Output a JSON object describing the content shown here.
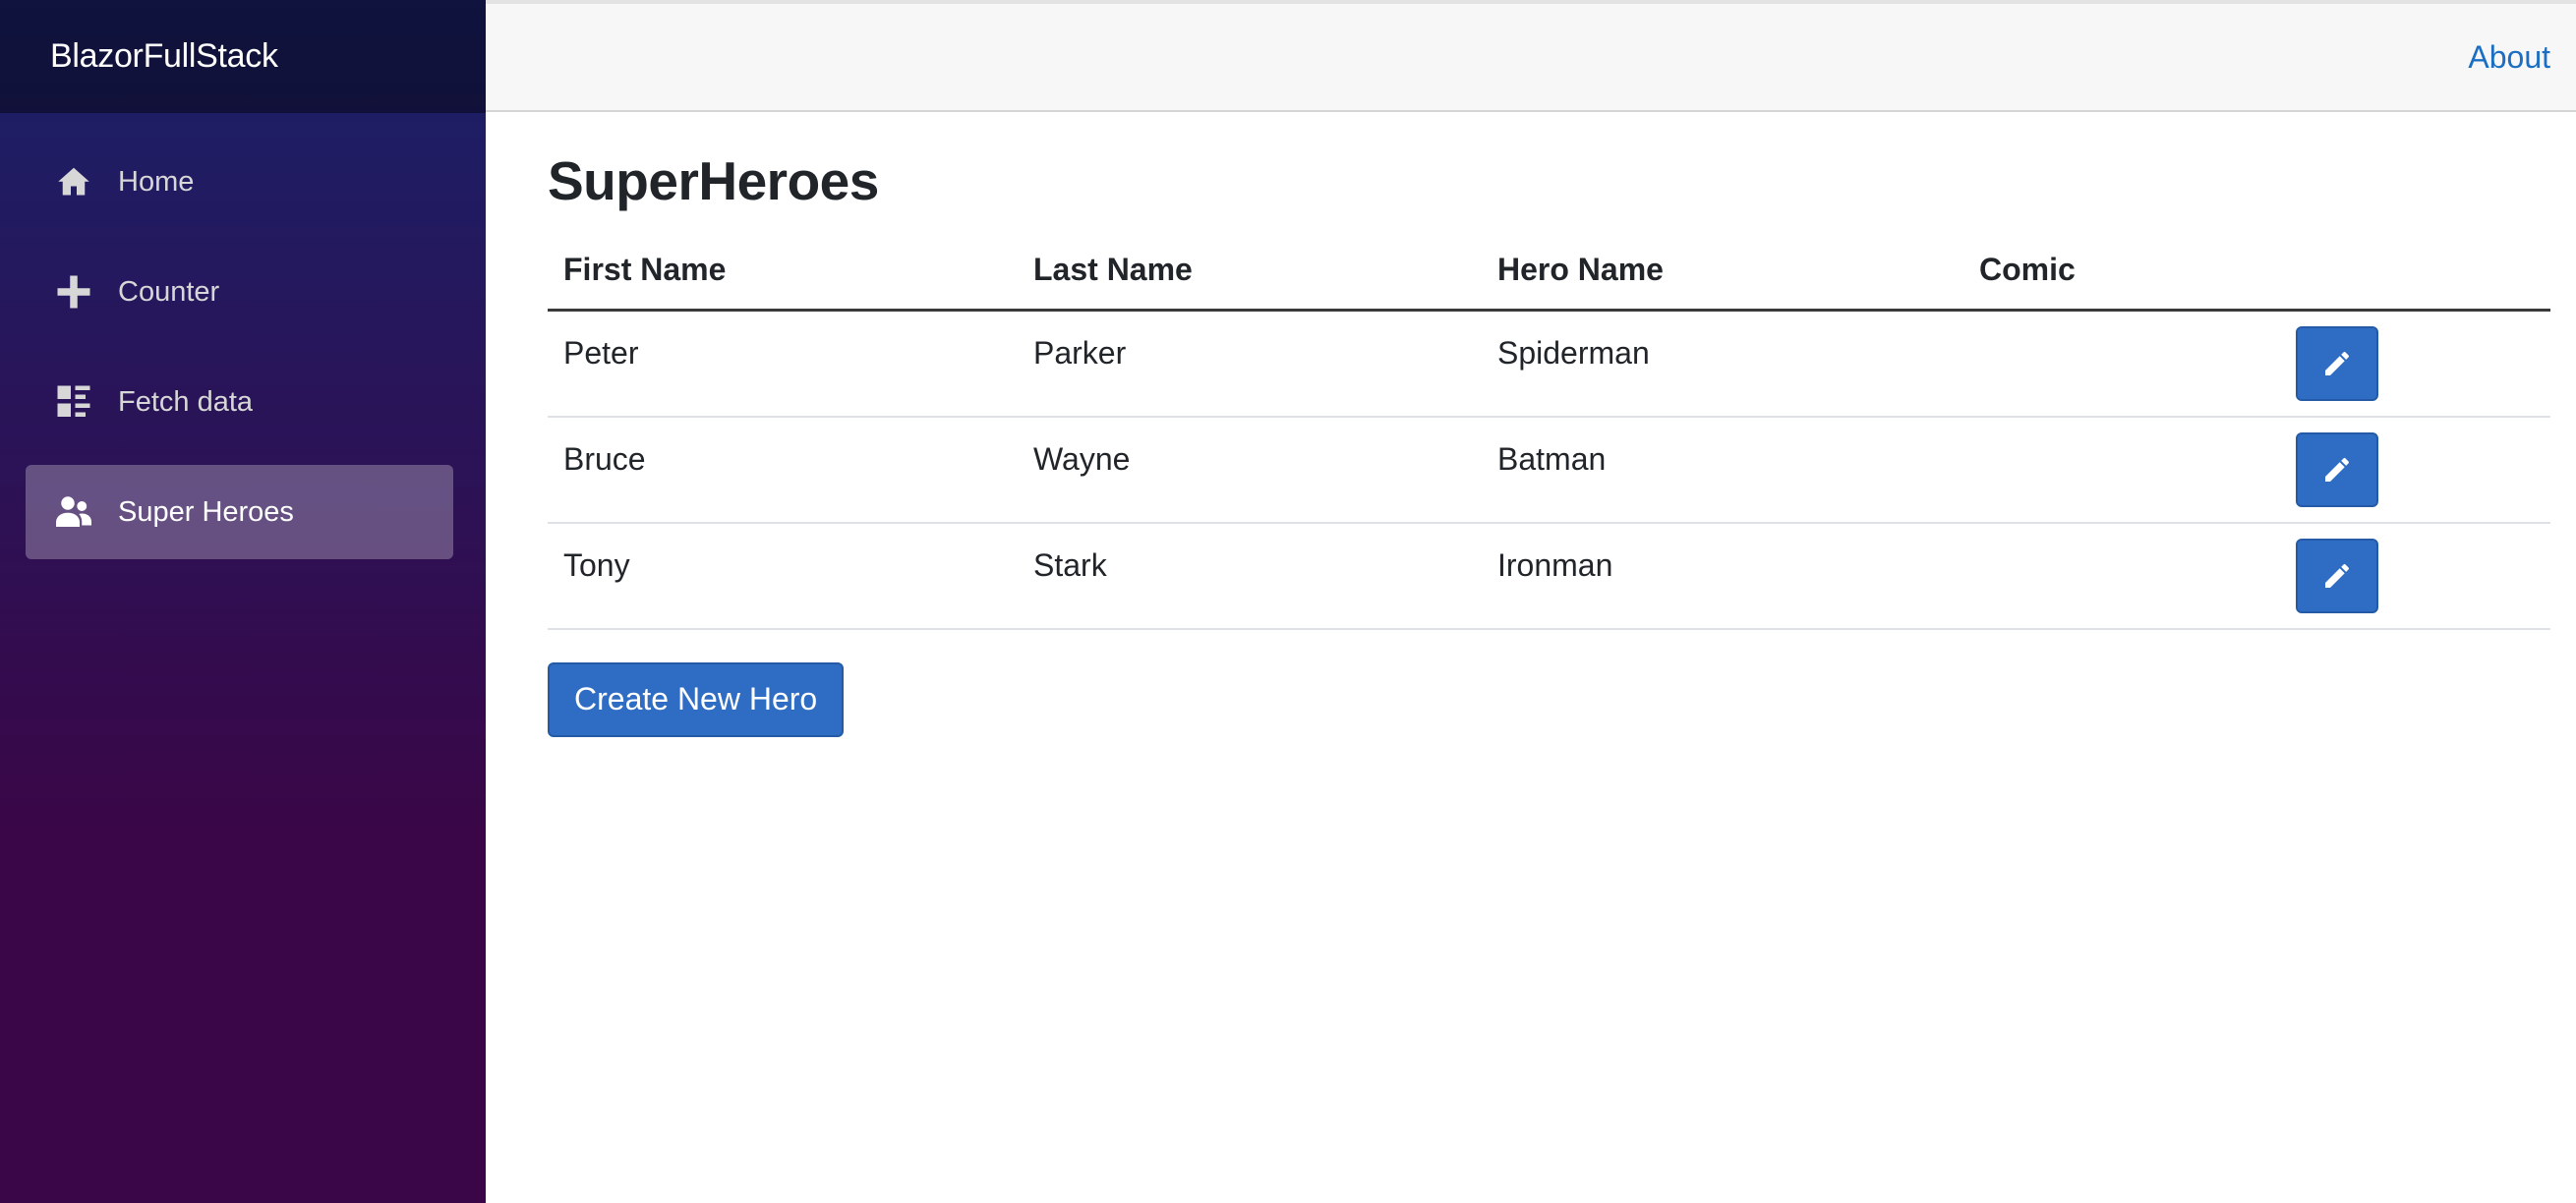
{
  "sidebar": {
    "brand": "BlazorFullStack",
    "items": [
      {
        "label": "Home",
        "icon": "home-icon",
        "active": false
      },
      {
        "label": "Counter",
        "icon": "plus-icon",
        "active": false
      },
      {
        "label": "Fetch data",
        "icon": "list-icon",
        "active": false
      },
      {
        "label": "Super Heroes",
        "icon": "people-icon",
        "active": true
      }
    ]
  },
  "topbar": {
    "about_label": "About"
  },
  "page": {
    "title": "SuperHeroes",
    "columns": [
      "First Name",
      "Last Name",
      "Hero Name",
      "Comic"
    ],
    "rows": [
      {
        "first_name": "Peter",
        "last_name": "Parker",
        "hero_name": "Spiderman",
        "comic": ""
      },
      {
        "first_name": "Bruce",
        "last_name": "Wayne",
        "hero_name": "Batman",
        "comic": ""
      },
      {
        "first_name": "Tony",
        "last_name": "Stark",
        "hero_name": "Ironman",
        "comic": ""
      }
    ],
    "create_label": "Create New Hero"
  },
  "colors": {
    "accent": "#2f6dc4",
    "link": "#1b6ec2",
    "sidebar_top": "#1a2169",
    "sidebar_bottom": "#3a0647"
  }
}
